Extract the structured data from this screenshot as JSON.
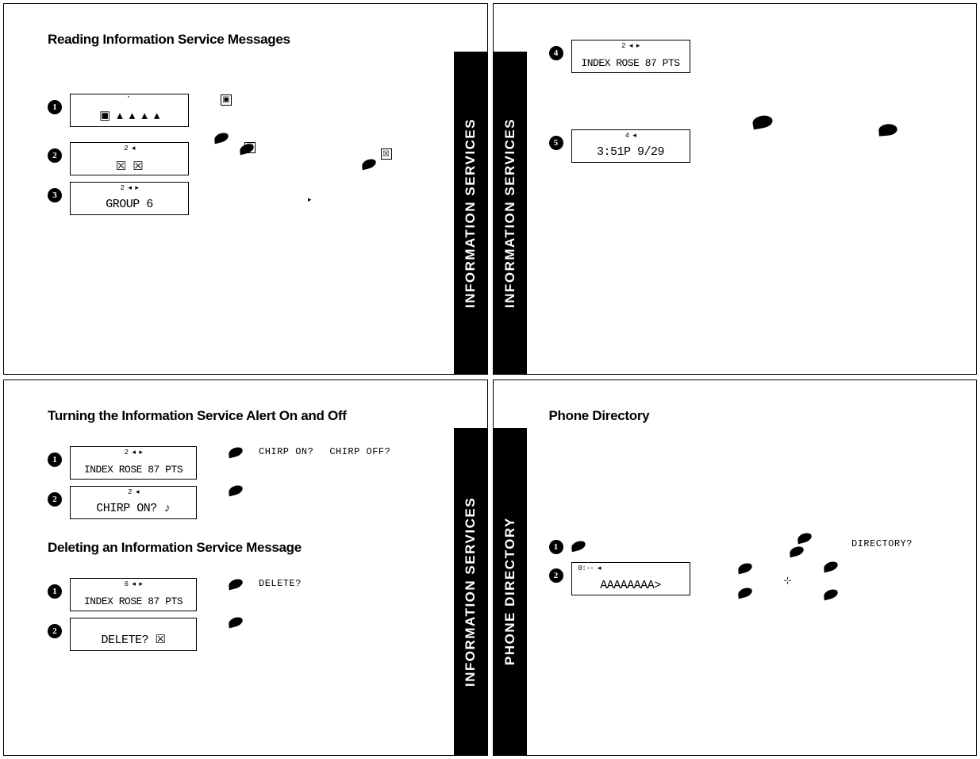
{
  "tabs": {
    "info_services": "INFORMATION SERVICES",
    "phone_directory": "PHONE DIRECTORY"
  },
  "tl": {
    "heading": "Reading Information Service Messages",
    "steps": {
      "s1": {
        "num": "1",
        "lcd_top": "⠁",
        "lcd_main": "▣ ▴ ▴ ▴ ▴"
      },
      "s2": {
        "num": "2",
        "lcd_top": "2   ◂",
        "lcd_main": "☒ ☒"
      },
      "s3": {
        "num": "3",
        "lcd_top": "2   ◂ ▸",
        "lcd_main": "GROUP 6"
      }
    }
  },
  "tr": {
    "steps": {
      "s4": {
        "num": "4",
        "lcd_top": "2   ◂ ▸",
        "lcd_main": "INDEX ROSE 87 PTS"
      },
      "s5": {
        "num": "5",
        "lcd_top": "4   ◂",
        "lcd_main": "3:51P 9/29"
      }
    }
  },
  "bl": {
    "heading1": "Turning the Information Service Alert On and Off",
    "alert_steps": {
      "s1": {
        "num": "1",
        "lcd_top": "2   ◂ ▸",
        "lcd_main": "INDEX ROSE 87 PTS",
        "right1": "CHIRP ON?",
        "right2": "CHIRP OFF?"
      },
      "s2": {
        "num": "2",
        "lcd_top": "2   ◂",
        "lcd_main": "CHIRP ON? ♪"
      }
    },
    "heading2": "Deleting an Information Service Message",
    "delete_steps": {
      "s1": {
        "num": "1",
        "lcd_top": "6   ◂ ▸",
        "lcd_main": "INDEX ROSE 87 PTS",
        "right1": "DELETE?"
      },
      "s2": {
        "num": "2",
        "lcd_top": "",
        "lcd_main": "DELETE? ☒"
      }
    }
  },
  "br": {
    "heading": "Phone Directory",
    "steps": {
      "s1": {
        "num": "1",
        "right1": "DIRECTORY?"
      },
      "s2": {
        "num": "2",
        "lcd_top": "0:--   ◂",
        "lcd_main": "AAAAAAAA>",
        "mid": "⊹"
      }
    }
  }
}
